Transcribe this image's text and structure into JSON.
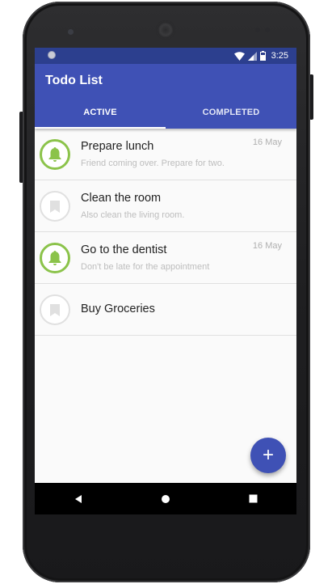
{
  "status_bar": {
    "time": "3:25"
  },
  "app": {
    "title": "Todo List"
  },
  "tabs": [
    {
      "label": "ACTIVE",
      "selected": true
    },
    {
      "label": "COMPLETED",
      "selected": false
    }
  ],
  "todos": [
    {
      "title": "Prepare lunch",
      "subtitle": "Friend coming over. Prepare for two.",
      "date": "16 May",
      "icon": "bell-icon",
      "reminder": true
    },
    {
      "title": "Clean the room",
      "subtitle": "Also clean the living room.",
      "date": "",
      "icon": "bookmark-icon",
      "reminder": false
    },
    {
      "title": "Go to the dentist",
      "subtitle": "Don't be late for the appointment",
      "date": "16 May",
      "icon": "bell-icon",
      "reminder": true
    },
    {
      "title": "Buy Groceries",
      "subtitle": "",
      "date": "",
      "icon": "bookmark-icon",
      "reminder": false
    }
  ],
  "fab": {
    "label": "+"
  },
  "colors": {
    "primary": "#3f51b5",
    "primary_dark": "#2c3f8e",
    "accent_green": "#8bc34a"
  }
}
